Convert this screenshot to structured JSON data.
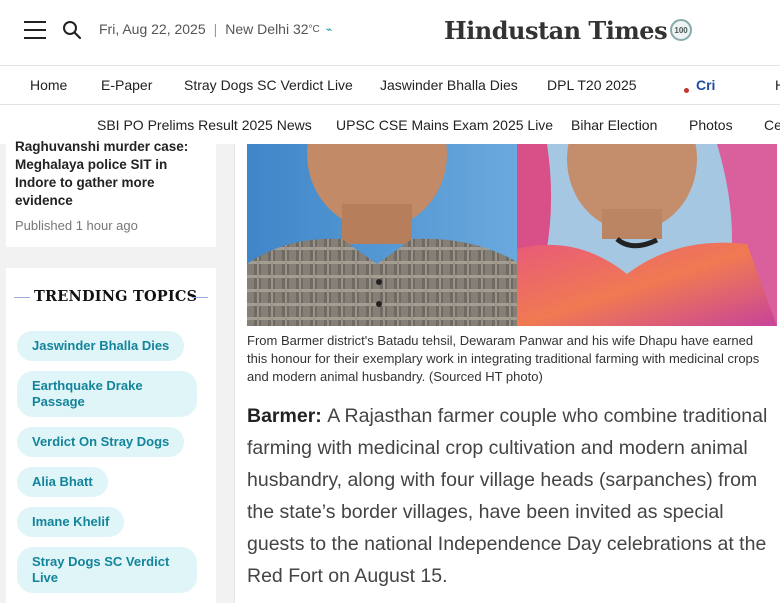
{
  "header": {
    "date": "Fri, Aug 22, 2025",
    "city_temp": "New Delhi 32",
    "temp_unit": "°C",
    "logo_text": "Hindustan Times",
    "logo_badge": "100"
  },
  "nav_primary": [
    "Home",
    "E-Paper",
    "Stray Dogs SC Verdict Live",
    "Jaswinder Bhalla Dies",
    "DPL T20 2025",
    "Cri",
    "H"
  ],
  "nav_secondary": [
    "SBI PO Prelims Result 2025 News",
    "UPSC CSE Mains Exam 2025 Live",
    "Bihar Election",
    "Photos",
    "Ce"
  ],
  "sidebar": {
    "story": {
      "title": "Raghuvanshi murder case: Meghalaya police SIT in Indore to gather more evidence",
      "published": "Published 1 hour ago"
    },
    "trending": {
      "heading": "TRENDING TOPICS",
      "topics": [
        "Jaswinder Bhalla Dies",
        "Earthquake Drake Passage",
        "Verdict On Stray Dogs",
        "Alia Bhatt",
        "Imane Khelif",
        "Stray Dogs SC Verdict Live"
      ]
    }
  },
  "article": {
    "caption": "From Barmer district's Batadu tehsil, Dewaram Panwar and his wife Dhapu have earned this honour for their exemplary work in integrating traditional farming with medicinal crops and modern animal husbandry. (Sourced HT photo)",
    "lead": "Barmer:",
    "body": "A Rajasthan farmer couple who combine traditional farming with medicinal crop cultivation and modern animal husbandry, along with four village heads (sarpanches) from the state’s border villages, have been invited as special guests to the national Independence Day celebrations at the Red Fort on August 15."
  },
  "colors": {
    "accent": "#12849b",
    "chip_bg": "#e0f5f8",
    "live_dot": "#c0392b",
    "cri_text": "#1f4f9c"
  },
  "icons": [
    "hamburger-menu-icon",
    "search-icon",
    "weather-icon",
    "live-dot-icon"
  ]
}
